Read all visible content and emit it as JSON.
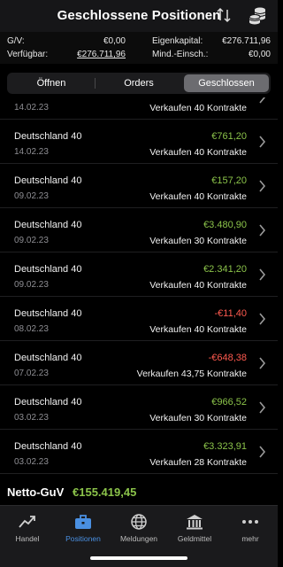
{
  "header": {
    "title": "Geschlossene Positionen"
  },
  "summary": {
    "gv_label": "G/V:",
    "gv_value": "€0,00",
    "verfuegbar_label": "Verfügbar:",
    "verfuegbar_value": "€276.711,96",
    "eigenkapital_label": "Eigenkapital:",
    "eigenkapital_value": "€276.711,96",
    "mind_label": "Mind.-Einsch.:",
    "mind_value": "€0,00"
  },
  "tabs_segment": {
    "open": "Öffnen",
    "orders": "Orders",
    "closed": "Geschlossen",
    "active": "closed"
  },
  "rows": [
    {
      "name": "",
      "date": "14.02.23",
      "pnl": "",
      "trade": "Verkaufen  40 Kontrakte",
      "pnl_sign": "pos"
    },
    {
      "name": "Deutschland 40",
      "date": "14.02.23",
      "pnl": "€761,20",
      "trade": "Verkaufen  40 Kontrakte",
      "pnl_sign": "pos"
    },
    {
      "name": "Deutschland 40",
      "date": "09.02.23",
      "pnl": "€157,20",
      "trade": "Verkaufen  40 Kontrakte",
      "pnl_sign": "pos"
    },
    {
      "name": "Deutschland 40",
      "date": "09.02.23",
      "pnl": "€3.480,90",
      "trade": "Verkaufen  30 Kontrakte",
      "pnl_sign": "pos"
    },
    {
      "name": "Deutschland 40",
      "date": "09.02.23",
      "pnl": "€2.341,20",
      "trade": "Verkaufen  40 Kontrakte",
      "pnl_sign": "pos"
    },
    {
      "name": "Deutschland 40",
      "date": "08.02.23",
      "pnl": "-€11,40",
      "trade": "Verkaufen  40 Kontrakte",
      "pnl_sign": "neg"
    },
    {
      "name": "Deutschland 40",
      "date": "07.02.23",
      "pnl": "-€648,38",
      "trade": "Verkaufen  43,75 Kontrakte",
      "pnl_sign": "neg"
    },
    {
      "name": "Deutschland 40",
      "date": "03.02.23",
      "pnl": "€966,52",
      "trade": "Verkaufen  30 Kontrakte",
      "pnl_sign": "pos"
    },
    {
      "name": "Deutschland 40",
      "date": "03.02.23",
      "pnl": "€3.323,91",
      "trade": "Verkaufen  28 Kontrakte",
      "pnl_sign": "pos"
    }
  ],
  "netto": {
    "label": "Netto-GuV",
    "value": "€155.419,45"
  },
  "tabbar": [
    {
      "label": "Handel",
      "icon": "chart-trend-icon"
    },
    {
      "label": "Positionen",
      "icon": "briefcase-icon",
      "active": true
    },
    {
      "label": "Meldungen",
      "icon": "globe-icon"
    },
    {
      "label": "Geldmittel",
      "icon": "bank-icon"
    },
    {
      "label": "mehr",
      "icon": "more-dots-icon"
    }
  ],
  "colors": {
    "positive": "#8bc34a",
    "negative": "#ff5a4f",
    "accent": "#4a90e2"
  }
}
